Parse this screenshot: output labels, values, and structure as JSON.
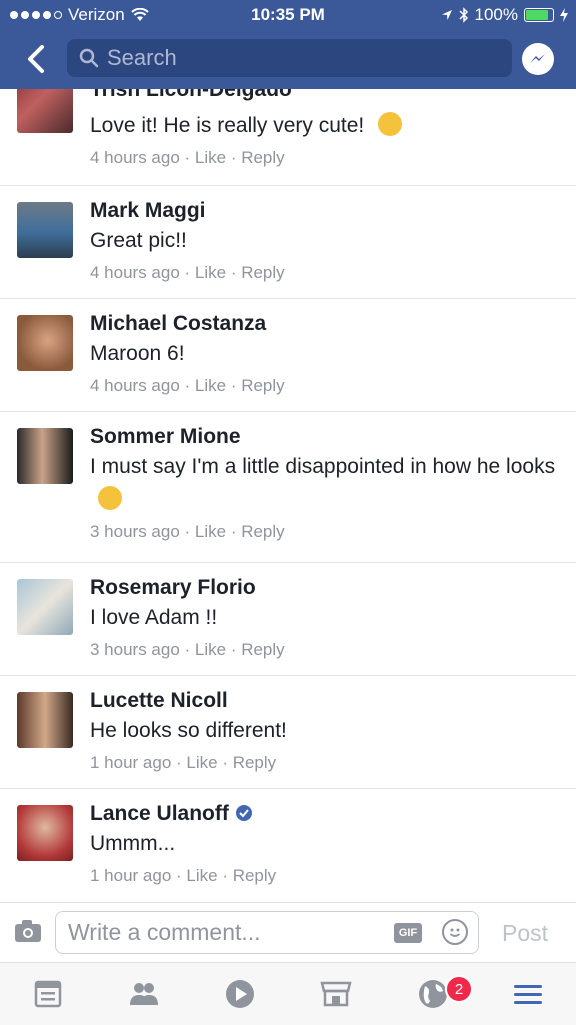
{
  "status_bar": {
    "carrier": "Verizon",
    "time": "10:35 PM",
    "battery": "100%"
  },
  "header": {
    "search_placeholder": "Search"
  },
  "comments": [
    {
      "name": "Trish Licon-Delgado",
      "text": "Love it! He is really very cute!",
      "time": "4 hours ago",
      "like": "Like",
      "reply": "Reply"
    },
    {
      "name": "Mark Maggi",
      "text": "Great pic!!",
      "time": "4 hours ago",
      "like": "Like",
      "reply": "Reply"
    },
    {
      "name": "Michael Costanza",
      "text": "Maroon 6!",
      "time": "4 hours ago",
      "like": "Like",
      "reply": "Reply"
    },
    {
      "name": "Sommer Mione",
      "text": "I must say I'm a little disappointed in how he looks",
      "time": "3 hours ago",
      "like": "Like",
      "reply": "Reply"
    },
    {
      "name": "Rosemary Florio",
      "text": "I love Adam !!",
      "time": "3 hours ago",
      "like": "Like",
      "reply": "Reply"
    },
    {
      "name": "Lucette Nicoll",
      "text": "He looks so different!",
      "time": "1 hour ago",
      "like": "Like",
      "reply": "Reply"
    },
    {
      "name": "Lance Ulanoff",
      "text": "Ummm...",
      "time": "1 hour ago",
      "like": "Like",
      "reply": "Reply"
    }
  ],
  "composer": {
    "placeholder": "Write a comment...",
    "gif_label": "GIF",
    "post_label": "Post"
  },
  "tabbar": {
    "notifications_badge": "2"
  },
  "colors": {
    "brand": "#3b5998",
    "meta": "#90949c",
    "badge": "#f02849",
    "active_tab": "#4267b2"
  }
}
